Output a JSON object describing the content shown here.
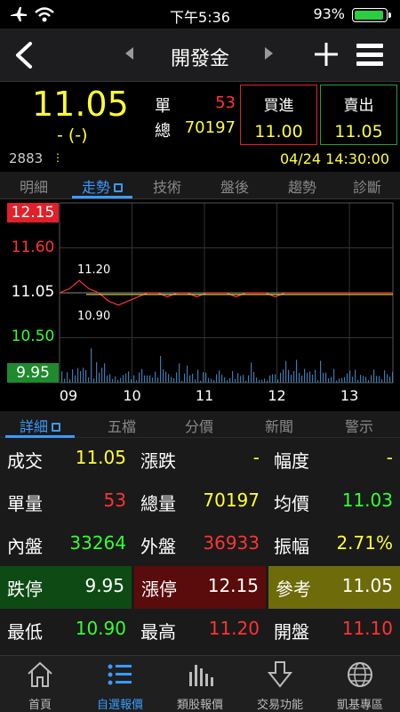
{
  "status": {
    "time": "下午5:36",
    "battery": "93%",
    "battery_level": 0.93
  },
  "nav": {
    "title": "開發金"
  },
  "quote": {
    "price": "11.05",
    "change": "- (-)",
    "unit_label": "單",
    "unit_value": "53",
    "total_label": "總",
    "total_value": "70197",
    "buy_label": "買進",
    "buy_value": "11.00",
    "sell_label": "賣出",
    "sell_value": "11.05",
    "code": "2883",
    "datetime": "04/24 14:30:00"
  },
  "top_tabs": [
    "明細",
    "走勢",
    "技術",
    "盤後",
    "趨勢",
    "診斷"
  ],
  "chart_data": {
    "type": "line",
    "y_ticks": [
      "12.15",
      "11.60",
      "11.05",
      "10.50",
      "9.95"
    ],
    "x_ticks": [
      "09",
      "10",
      "11",
      "12",
      "13"
    ],
    "annotations": {
      "high": "11.20",
      "low": "10.90"
    },
    "ylim": [
      9.95,
      12.15
    ],
    "reference": 11.05,
    "series": [
      {
        "values": [
          11.05,
          11.1,
          11.2,
          11.1,
          11.05,
          10.95,
          10.9,
          10.95,
          11.0,
          11.05,
          11.05,
          11.0,
          11.05,
          11.05,
          11.0,
          11.05,
          11.05,
          11.05,
          11.0,
          11.05,
          11.05,
          11.05,
          11.0,
          11.05,
          11.05,
          11.05,
          11.05,
          11.05,
          11.05,
          11.05,
          11.05,
          11.05,
          11.05,
          11.05,
          11.05
        ]
      }
    ]
  },
  "lower_tabs": [
    "詳細",
    "五檔",
    "分價",
    "新聞",
    "警示"
  ],
  "detail": {
    "r1": [
      {
        "l": "成交",
        "v": "11.05"
      },
      {
        "l": "漲跌",
        "v": "-"
      },
      {
        "l": "幅度",
        "v": "-"
      }
    ],
    "r2": [
      {
        "l": "單量",
        "v": "53"
      },
      {
        "l": "總量",
        "v": "70197"
      },
      {
        "l": "均價",
        "v": "11.03"
      }
    ],
    "r3": [
      {
        "l": "內盤",
        "v": "33264"
      },
      {
        "l": "外盤",
        "v": "36933"
      },
      {
        "l": "振幅",
        "v": "2.71%"
      }
    ],
    "r4": [
      {
        "l": "跌停",
        "v": "9.95"
      },
      {
        "l": "漲停",
        "v": "12.15"
      },
      {
        "l": "參考",
        "v": "11.05"
      }
    ],
    "r5": [
      {
        "l": "最低",
        "v": "10.90"
      },
      {
        "l": "最高",
        "v": "11.20"
      },
      {
        "l": "開盤",
        "v": "11.10"
      }
    ]
  },
  "bottom_nav": [
    "首頁",
    "自選報價",
    "類股報價",
    "交易功能",
    "凱基專區"
  ]
}
